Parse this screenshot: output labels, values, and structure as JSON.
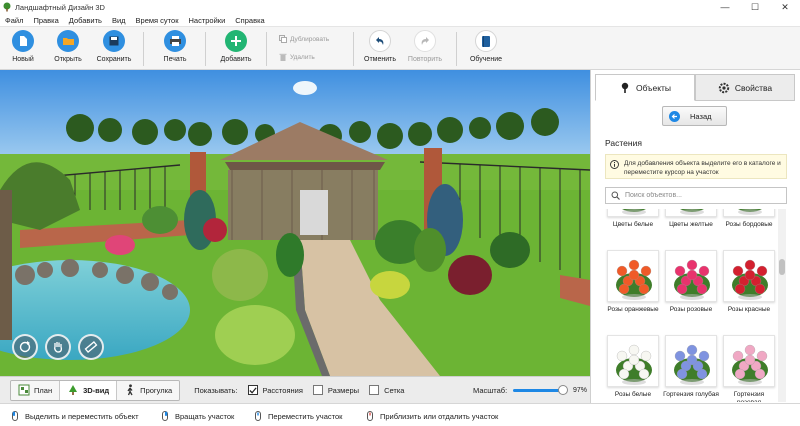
{
  "window": {
    "title": "Ландшафтный Дизайн 3D",
    "controls": [
      "—",
      "☐",
      "✕"
    ]
  },
  "menu": [
    "Файл",
    "Правка",
    "Добавить",
    "Вид",
    "Время суток",
    "Настройки",
    "Справка"
  ],
  "toolbar": {
    "new": "Новый",
    "open": "Открыть",
    "save": "Сохранить",
    "print": "Печать",
    "add": "Добавить",
    "duplicate": "Дублировать",
    "delete": "Удалить",
    "undo": "Отменить",
    "redo": "Повторить",
    "learn": "Обучение"
  },
  "view_modes": [
    {
      "label": "План",
      "active": false
    },
    {
      "label": "3D-вид",
      "active": true
    },
    {
      "label": "Прогулка",
      "active": false
    }
  ],
  "show": {
    "label": "Показывать:",
    "options": [
      {
        "label": "Расстояния",
        "checked": true
      },
      {
        "label": "Размеры",
        "checked": false
      },
      {
        "label": "Сетка",
        "checked": false
      }
    ]
  },
  "scale": {
    "label": "Масштаб:",
    "value": "97%",
    "percent": 97
  },
  "hints": [
    "Выделить и переместить объект",
    "Вращать участок",
    "Переместить участок",
    "Приблизить или отдалить участок"
  ],
  "panel": {
    "tabs": [
      "Объекты",
      "Свойства"
    ],
    "active_tab": 0,
    "back": "Назад",
    "section": "Растения",
    "info": "Для добавления объекта выделите его в каталоге и переместите курсор на участок",
    "search_placeholder": "Поиск объектов...",
    "items": [
      {
        "name": "Цветы белые",
        "flower": "#ffffff"
      },
      {
        "name": "Цветы желтые",
        "flower": "#f4d03f"
      },
      {
        "name": "Розы бордовые",
        "flower": "#8e1b2b"
      },
      {
        "name": "Розы оранжевые",
        "flower": "#f05a28"
      },
      {
        "name": "Розы розовые",
        "flower": "#e8336d"
      },
      {
        "name": "Розы красные",
        "flower": "#d3202f"
      },
      {
        "name": "Розы белые",
        "flower": "#f7f7f2"
      },
      {
        "name": "Гортензия голубая",
        "flower": "#7f93e0"
      },
      {
        "name": "Гортензия розовая",
        "flower": "#f0a8c4"
      }
    ]
  },
  "colors": {
    "accent": "#1e88e5",
    "add": "#22b573",
    "folder": "#f5a623"
  }
}
